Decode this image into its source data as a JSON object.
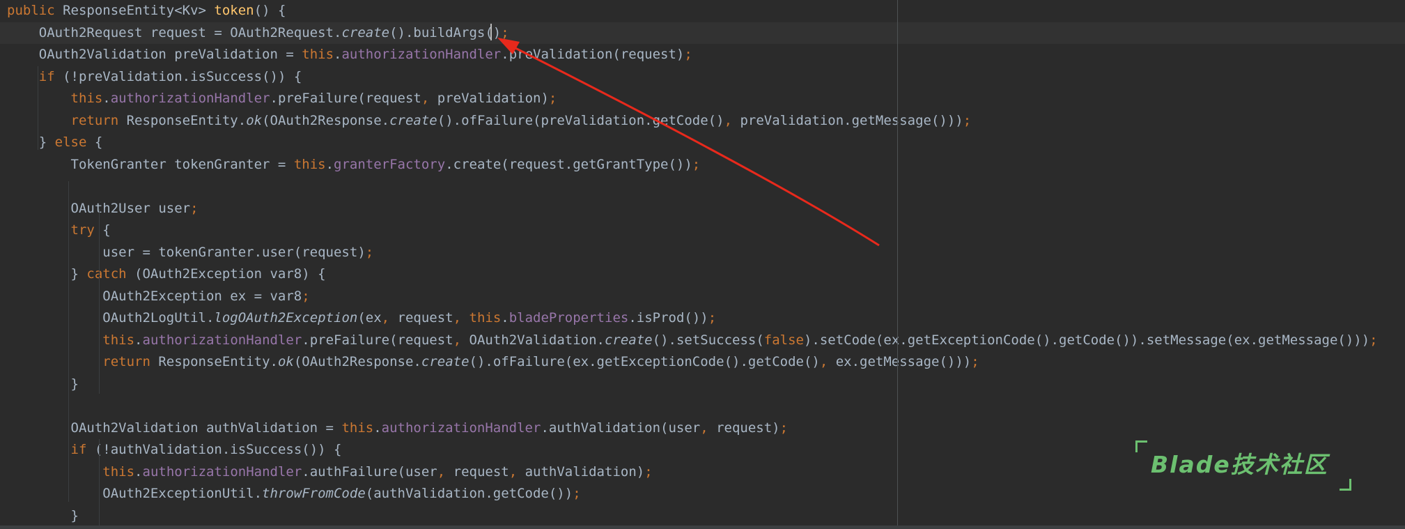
{
  "colors": {
    "background": "#2b2b2b",
    "current_line": "#323232",
    "keyword": "#cc7832",
    "field": "#9876aa",
    "method_decl": "#ffc66d",
    "text": "#a9b7c6",
    "annotation_arrow": "#e8291c",
    "watermark": "#6cc070"
  },
  "editor": {
    "current_line_index": 1,
    "lines": [
      [
        [
          "kw",
          "public "
        ],
        [
          "plain",
          "ResponseEntity<Kv> "
        ],
        [
          "method",
          "token"
        ],
        [
          "plain",
          "() {"
        ]
      ],
      [
        [
          "plain",
          "    OAuth2Request request = OAuth2Request."
        ],
        [
          "italic",
          "create"
        ],
        [
          "plain",
          "().buildArgs()"
        ],
        [
          "punct",
          ";"
        ]
      ],
      [
        [
          "plain",
          "    OAuth2Validation preValidation = "
        ],
        [
          "kw",
          "this"
        ],
        [
          "plain",
          "."
        ],
        [
          "field",
          "authorizationHandler"
        ],
        [
          "plain",
          ".preValidation(request)"
        ],
        [
          "punct",
          ";"
        ]
      ],
      [
        [
          "plain",
          "    "
        ],
        [
          "kw",
          "if "
        ],
        [
          "plain",
          "(!preValidation.isSuccess()) {"
        ]
      ],
      [
        [
          "plain",
          "        "
        ],
        [
          "kw",
          "this"
        ],
        [
          "plain",
          "."
        ],
        [
          "field",
          "authorizationHandler"
        ],
        [
          "plain",
          ".preFailure(request"
        ],
        [
          "punct",
          ", "
        ],
        [
          "plain",
          "preValidation)"
        ],
        [
          "punct",
          ";"
        ]
      ],
      [
        [
          "plain",
          "        "
        ],
        [
          "kw",
          "return "
        ],
        [
          "plain",
          "ResponseEntity."
        ],
        [
          "italic",
          "ok"
        ],
        [
          "plain",
          "(OAuth2Response."
        ],
        [
          "italic",
          "create"
        ],
        [
          "plain",
          "().ofFailure(preValidation.getCode()"
        ],
        [
          "punct",
          ", "
        ],
        [
          "plain",
          "preValidation.getMessage()))"
        ],
        [
          "punct",
          ";"
        ]
      ],
      [
        [
          "plain",
          "    } "
        ],
        [
          "kw",
          "else "
        ],
        [
          "plain",
          "{"
        ]
      ],
      [
        [
          "plain",
          "        TokenGranter tokenGranter = "
        ],
        [
          "kw",
          "this"
        ],
        [
          "plain",
          "."
        ],
        [
          "field",
          "granterFactory"
        ],
        [
          "plain",
          ".create(request.getGrantType())"
        ],
        [
          "punct",
          ";"
        ]
      ],
      [],
      [
        [
          "plain",
          "        OAuth2User user"
        ],
        [
          "punct",
          ";"
        ]
      ],
      [
        [
          "plain",
          "        "
        ],
        [
          "kw",
          "try "
        ],
        [
          "plain",
          "{"
        ]
      ],
      [
        [
          "plain",
          "            user = tokenGranter.user(request)"
        ],
        [
          "punct",
          ";"
        ]
      ],
      [
        [
          "plain",
          "        } "
        ],
        [
          "kw",
          "catch "
        ],
        [
          "plain",
          "(OAuth2Exception var8) {"
        ]
      ],
      [
        [
          "plain",
          "            OAuth2Exception ex = var8"
        ],
        [
          "punct",
          ";"
        ]
      ],
      [
        [
          "plain",
          "            OAuth2LogUtil."
        ],
        [
          "italic",
          "logOAuth2Exception"
        ],
        [
          "plain",
          "(ex"
        ],
        [
          "punct",
          ", "
        ],
        [
          "plain",
          "request"
        ],
        [
          "punct",
          ", "
        ],
        [
          "kw",
          "this"
        ],
        [
          "plain",
          "."
        ],
        [
          "field",
          "bladeProperties"
        ],
        [
          "plain",
          ".isProd())"
        ],
        [
          "punct",
          ";"
        ]
      ],
      [
        [
          "plain",
          "            "
        ],
        [
          "kw",
          "this"
        ],
        [
          "plain",
          "."
        ],
        [
          "field",
          "authorizationHandler"
        ],
        [
          "plain",
          ".preFailure(request"
        ],
        [
          "punct",
          ", "
        ],
        [
          "plain",
          "OAuth2Validation."
        ],
        [
          "italic",
          "create"
        ],
        [
          "plain",
          "().setSuccess("
        ],
        [
          "kw",
          "false"
        ],
        [
          "plain",
          ").setCode(ex.getExceptionCode().getCode()).setMessage(ex.getMessage()))"
        ],
        [
          "punct",
          ";"
        ]
      ],
      [
        [
          "plain",
          "            "
        ],
        [
          "kw",
          "return "
        ],
        [
          "plain",
          "ResponseEntity."
        ],
        [
          "italic",
          "ok"
        ],
        [
          "plain",
          "(OAuth2Response."
        ],
        [
          "italic",
          "create"
        ],
        [
          "plain",
          "().ofFailure(ex.getExceptionCode().getCode()"
        ],
        [
          "punct",
          ", "
        ],
        [
          "plain",
          "ex.getMessage()))"
        ],
        [
          "punct",
          ";"
        ]
      ],
      [
        [
          "plain",
          "        }"
        ]
      ],
      [],
      [
        [
          "plain",
          "        OAuth2Validation authValidation = "
        ],
        [
          "kw",
          "this"
        ],
        [
          "plain",
          "."
        ],
        [
          "field",
          "authorizationHandler"
        ],
        [
          "plain",
          ".authValidation(user"
        ],
        [
          "punct",
          ", "
        ],
        [
          "plain",
          "request)"
        ],
        [
          "punct",
          ";"
        ]
      ],
      [
        [
          "plain",
          "        "
        ],
        [
          "kw",
          "if "
        ],
        [
          "plain",
          "(!authValidation.isSuccess()) {"
        ]
      ],
      [
        [
          "plain",
          "            "
        ],
        [
          "kw",
          "this"
        ],
        [
          "plain",
          "."
        ],
        [
          "field",
          "authorizationHandler"
        ],
        [
          "plain",
          ".authFailure(user"
        ],
        [
          "punct",
          ", "
        ],
        [
          "plain",
          "request"
        ],
        [
          "punct",
          ", "
        ],
        [
          "plain",
          "authValidation)"
        ],
        [
          "punct",
          ";"
        ]
      ],
      [
        [
          "plain",
          "            OAuth2ExceptionUtil."
        ],
        [
          "italic",
          "throwFromCode"
        ],
        [
          "plain",
          "(authValidation.getCode())"
        ],
        [
          "punct",
          ";"
        ]
      ],
      [
        [
          "plain",
          "        }"
        ]
      ]
    ]
  },
  "annotation": {
    "arrow_icon": "red-arrow-icon"
  },
  "watermark": {
    "text": "Blade技术社区"
  }
}
